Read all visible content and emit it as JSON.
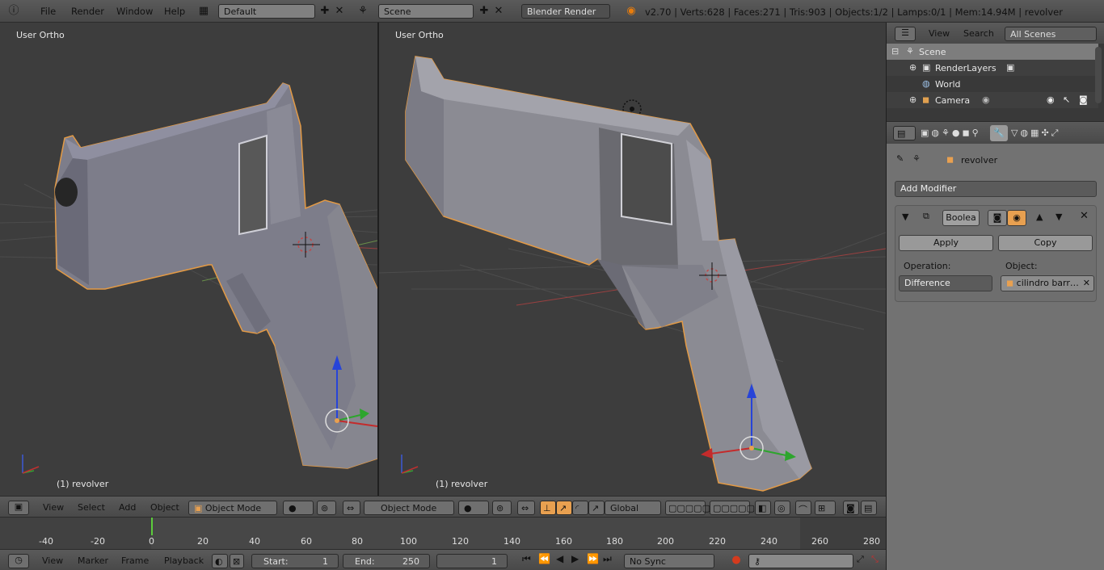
{
  "topbar": {
    "menus": [
      "File",
      "Render",
      "Window",
      "Help"
    ],
    "layout": "Default",
    "scene": "Scene",
    "engine": "Blender Render",
    "stats": "v2.70 | Verts:628 | Faces:271 | Tris:903 | Objects:1/2 | Lamps:0/1 | Mem:14.94M | revolver"
  },
  "viewports": {
    "left": {
      "title": "User Ortho",
      "object_label": "(1) revolver"
    },
    "right": {
      "title": "User Ortho",
      "object_label": "(1) revolver"
    }
  },
  "view3d_header": {
    "menus": [
      "View",
      "Select",
      "Add",
      "Object"
    ],
    "mode": "Object Mode",
    "mode2": "Object Mode",
    "orientation": "Global"
  },
  "timeline": {
    "ticks": [
      "-40",
      "-20",
      "0",
      "20",
      "40",
      "60",
      "80",
      "100",
      "120",
      "140",
      "160",
      "180",
      "200",
      "220",
      "240",
      "260",
      "280"
    ],
    "menus": [
      "View",
      "Marker",
      "Frame",
      "Playback"
    ],
    "start_label": "Start:",
    "start_value": "1",
    "end_label": "End:",
    "end_value": "250",
    "current_frame": "1",
    "sync": "No Sync"
  },
  "outliner": {
    "menus": [
      "View",
      "Search"
    ],
    "filter": "All Scenes",
    "items": [
      "Scene",
      "RenderLayers",
      "World",
      "Camera"
    ]
  },
  "properties": {
    "object_name": "revolver",
    "add_modifier": "Add Modifier",
    "modifier_name": "Boolea",
    "apply": "Apply",
    "copy": "Copy",
    "operation_label": "Operation:",
    "object_label": "Object:",
    "operation": "Difference",
    "object": "cilindro barr…"
  }
}
